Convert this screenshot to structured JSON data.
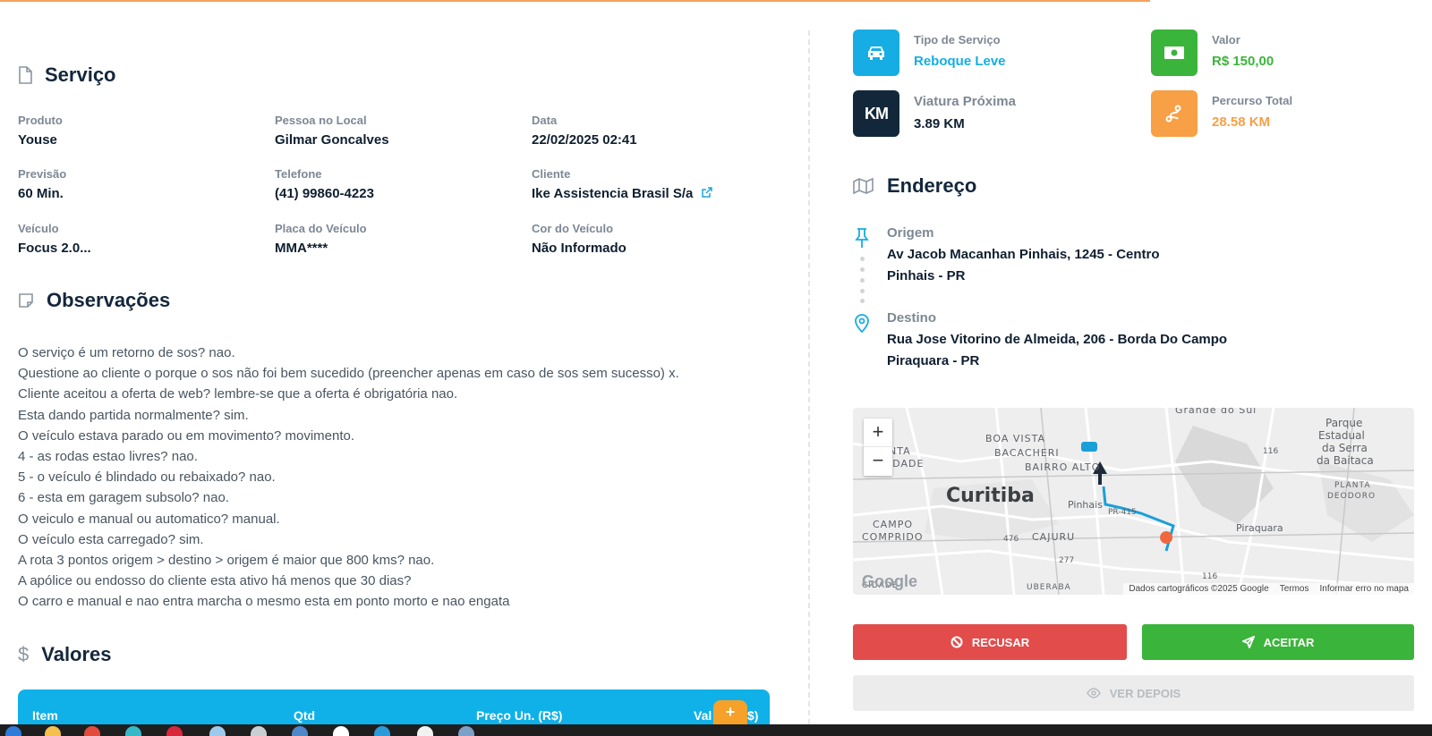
{
  "servico": {
    "title": "Serviço",
    "fields": [
      {
        "label": "Produto",
        "value": "Youse"
      },
      {
        "label": "Pessoa no Local",
        "value": "Gilmar Goncalves"
      },
      {
        "label": "Data",
        "value": "22/02/2025 02:41"
      },
      {
        "label": "Previsão",
        "value": "60 Min."
      },
      {
        "label": "Telefone",
        "value": "(41) 99860-4223"
      },
      {
        "label": "Cliente",
        "value": "Ike Assistencia Brasil S/a"
      },
      {
        "label": "Veículo",
        "value": "Focus 2.0..."
      },
      {
        "label": "Placa do Veículo",
        "value": "MMA****"
      },
      {
        "label": "Cor do Veículo",
        "value": "Não Informado"
      }
    ]
  },
  "observacoes": {
    "title": "Observações",
    "lines": [
      "O serviço é um retorno de sos? nao.",
      "Questione ao cliente o porque o sos não foi bem sucedido (preencher apenas em caso de sos sem sucesso) x.",
      "Cliente aceitou a oferta de web? lembre-se que a oferta é obrigatória nao.",
      "Esta dando partida normalmente? sim.",
      "O veículo estava parado ou em movimento? movimento.",
      "4 - as rodas estao livres? nao.",
      "5 - o veículo é blindado ou rebaixado? nao.",
      "6 - esta em garagem subsolo? nao.",
      "O veiculo e manual ou automatico? manual.",
      "O veículo esta carregado? sim.",
      "A rota 3 pontos origem > destino > origem é maior que 800 kms? nao.",
      "A apólice ou endosso do cliente esta ativo há menos que 30 dias?",
      "O carro e manual e nao entra marcha o mesmo esta em ponto morto e nao engata"
    ]
  },
  "valores": {
    "title": "Valores",
    "columns": [
      "Item",
      "Qtd",
      "Preço Un. (R$)",
      "Val",
      "$)"
    ],
    "add_label": "+"
  },
  "stats": {
    "tipo": {
      "label": "Tipo de Serviço",
      "value": "Reboque Leve",
      "color": "#16ade4"
    },
    "valor": {
      "label": "Valor",
      "value": "R$ 150,00",
      "color": "#3ab43a"
    },
    "viatura": {
      "label": "Viatura Próxima",
      "value": "3.89 KM",
      "icon_text": "KM",
      "color": "#12283a"
    },
    "percurso": {
      "label": "Percurso Total",
      "value": "28.58 KM",
      "color": "#f7a045"
    }
  },
  "endereco": {
    "title": "Endereço",
    "origem": {
      "label": "Origem",
      "line1": "Av Jacob Macanhan Pinhais, 1245 - Centro",
      "line2": "Pinhais - PR"
    },
    "destino": {
      "label": "Destino",
      "line1": "Rua Jose Vitorino de Almeida, 206 - Borda Do Campo",
      "line2": "Piraquara - PR"
    }
  },
  "map": {
    "zoom_in": "+",
    "zoom_out": "−",
    "labels": [
      "Grande do Sul",
      "BOA VISTA",
      "BACACHERI",
      "BAIRRO ALTO",
      "NTA",
      "IDADE",
      "Curitiba",
      "Pinhais",
      "PR-415",
      "CAMPO",
      "COMPRIDO",
      "CAJURU",
      "476",
      "277",
      "Piraquara",
      "116",
      "Parque",
      "Estadual",
      "da Serra",
      "da Baitaca",
      "PLANTA",
      "DEODORO",
      "UBERABA",
      "CIDADE",
      "116"
    ],
    "logo": "Google",
    "attribution": "Dados cartográficos ©2025 Google",
    "terms": "Termos",
    "report": "Informar erro no mapa"
  },
  "actions": {
    "refuse": "RECUSAR",
    "accept": "ACEITAR",
    "later": "VER DEPOIS"
  }
}
